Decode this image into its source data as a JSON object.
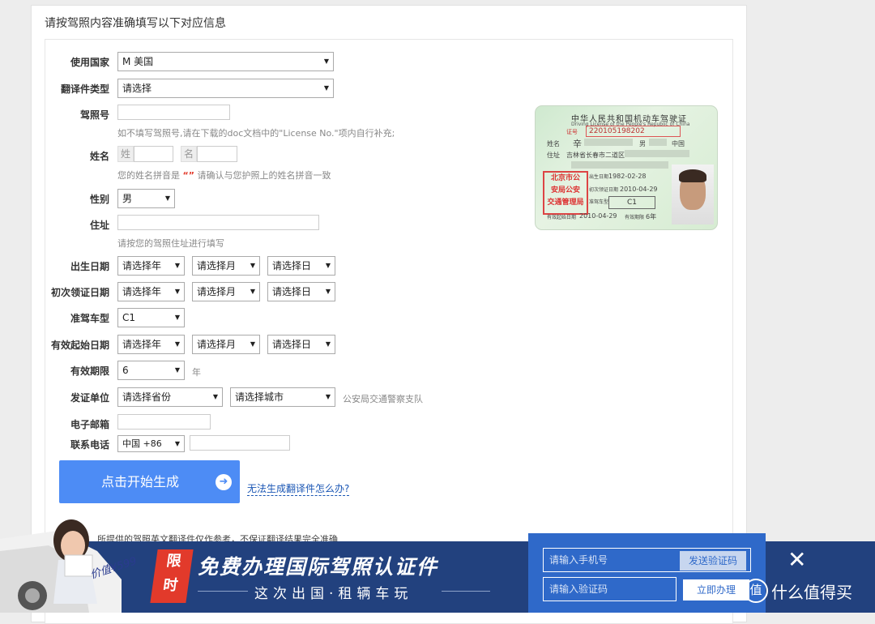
{
  "heading": "请按驾照内容准确填写以下对应信息",
  "fields": {
    "country": {
      "label": "使用国家",
      "value": "M 美国"
    },
    "doc_type": {
      "label": "翻译件类型",
      "value": "请选择"
    },
    "license_no": {
      "label": "驾照号",
      "hint": "如不填写驾照号,请在下载的doc文档中的\"License No.\"项内自行补充;"
    },
    "name": {
      "label": "姓名",
      "surname_ph": "姓",
      "given_ph": "名",
      "hint_pre": "您的姓名拼音是",
      "hint_mark": "“”",
      "hint_post": "请确认与您护照上的姓名拼音一致"
    },
    "gender": {
      "label": "性别",
      "value": "男"
    },
    "address": {
      "label": "住址",
      "hint": "请按您的驾照住址进行填写"
    },
    "birth": {
      "label": "出生日期",
      "year": "请选择年",
      "month": "请选择月",
      "day": "请选择日"
    },
    "first_issue": {
      "label": "初次领证日期",
      "year": "请选择年",
      "month": "请选择月",
      "day": "请选择日"
    },
    "vehicle_class": {
      "label": "准驾车型",
      "value": "C1"
    },
    "valid_from": {
      "label": "有效起始日期",
      "year": "请选择年",
      "month": "请选择月",
      "day": "请选择日"
    },
    "validity": {
      "label": "有效期限",
      "value": "6",
      "unit": "年"
    },
    "issuer": {
      "label": "发证单位",
      "province": "请选择省份",
      "city": "请选择城市",
      "suffix": "公安局交通警察支队"
    },
    "email": {
      "label": "电子邮箱"
    },
    "phone": {
      "label": "联系电话",
      "code": "中国 +86"
    }
  },
  "actions": {
    "generate": "点击开始生成",
    "help": "无法生成翻译件怎么办?"
  },
  "card": {
    "title": "中华人民共和国机动车驾驶证",
    "subtitle": "Driving License of the People's Republic of China",
    "number": "220105198202",
    "name_char": "辛",
    "gender": "男",
    "country": "中国",
    "address": "吉林省长春市二道区",
    "birth": "1982-02-28",
    "first_issue": "2010-04-29",
    "class": "C1",
    "valid_from": "2010-04-29",
    "valid_years": "6年",
    "seal": [
      "北京市公",
      "安局公安",
      "交通管理局"
    ]
  },
  "disclaimer": "所提供的驾照英文翻译件仅作参考，不保证翻译结果完全准确",
  "banner": {
    "price": "价值¥599",
    "badge": [
      "限",
      "时"
    ],
    "title": "免费办理国际驾照认证件",
    "subtitle": "这次出国·租辆车玩",
    "phone_ph": "请输入手机号",
    "send_code": "发送验证码",
    "code_ph": "请输入验证码",
    "apply": "立即办理",
    "brand_icon": "值",
    "brand": "什么值得买"
  }
}
